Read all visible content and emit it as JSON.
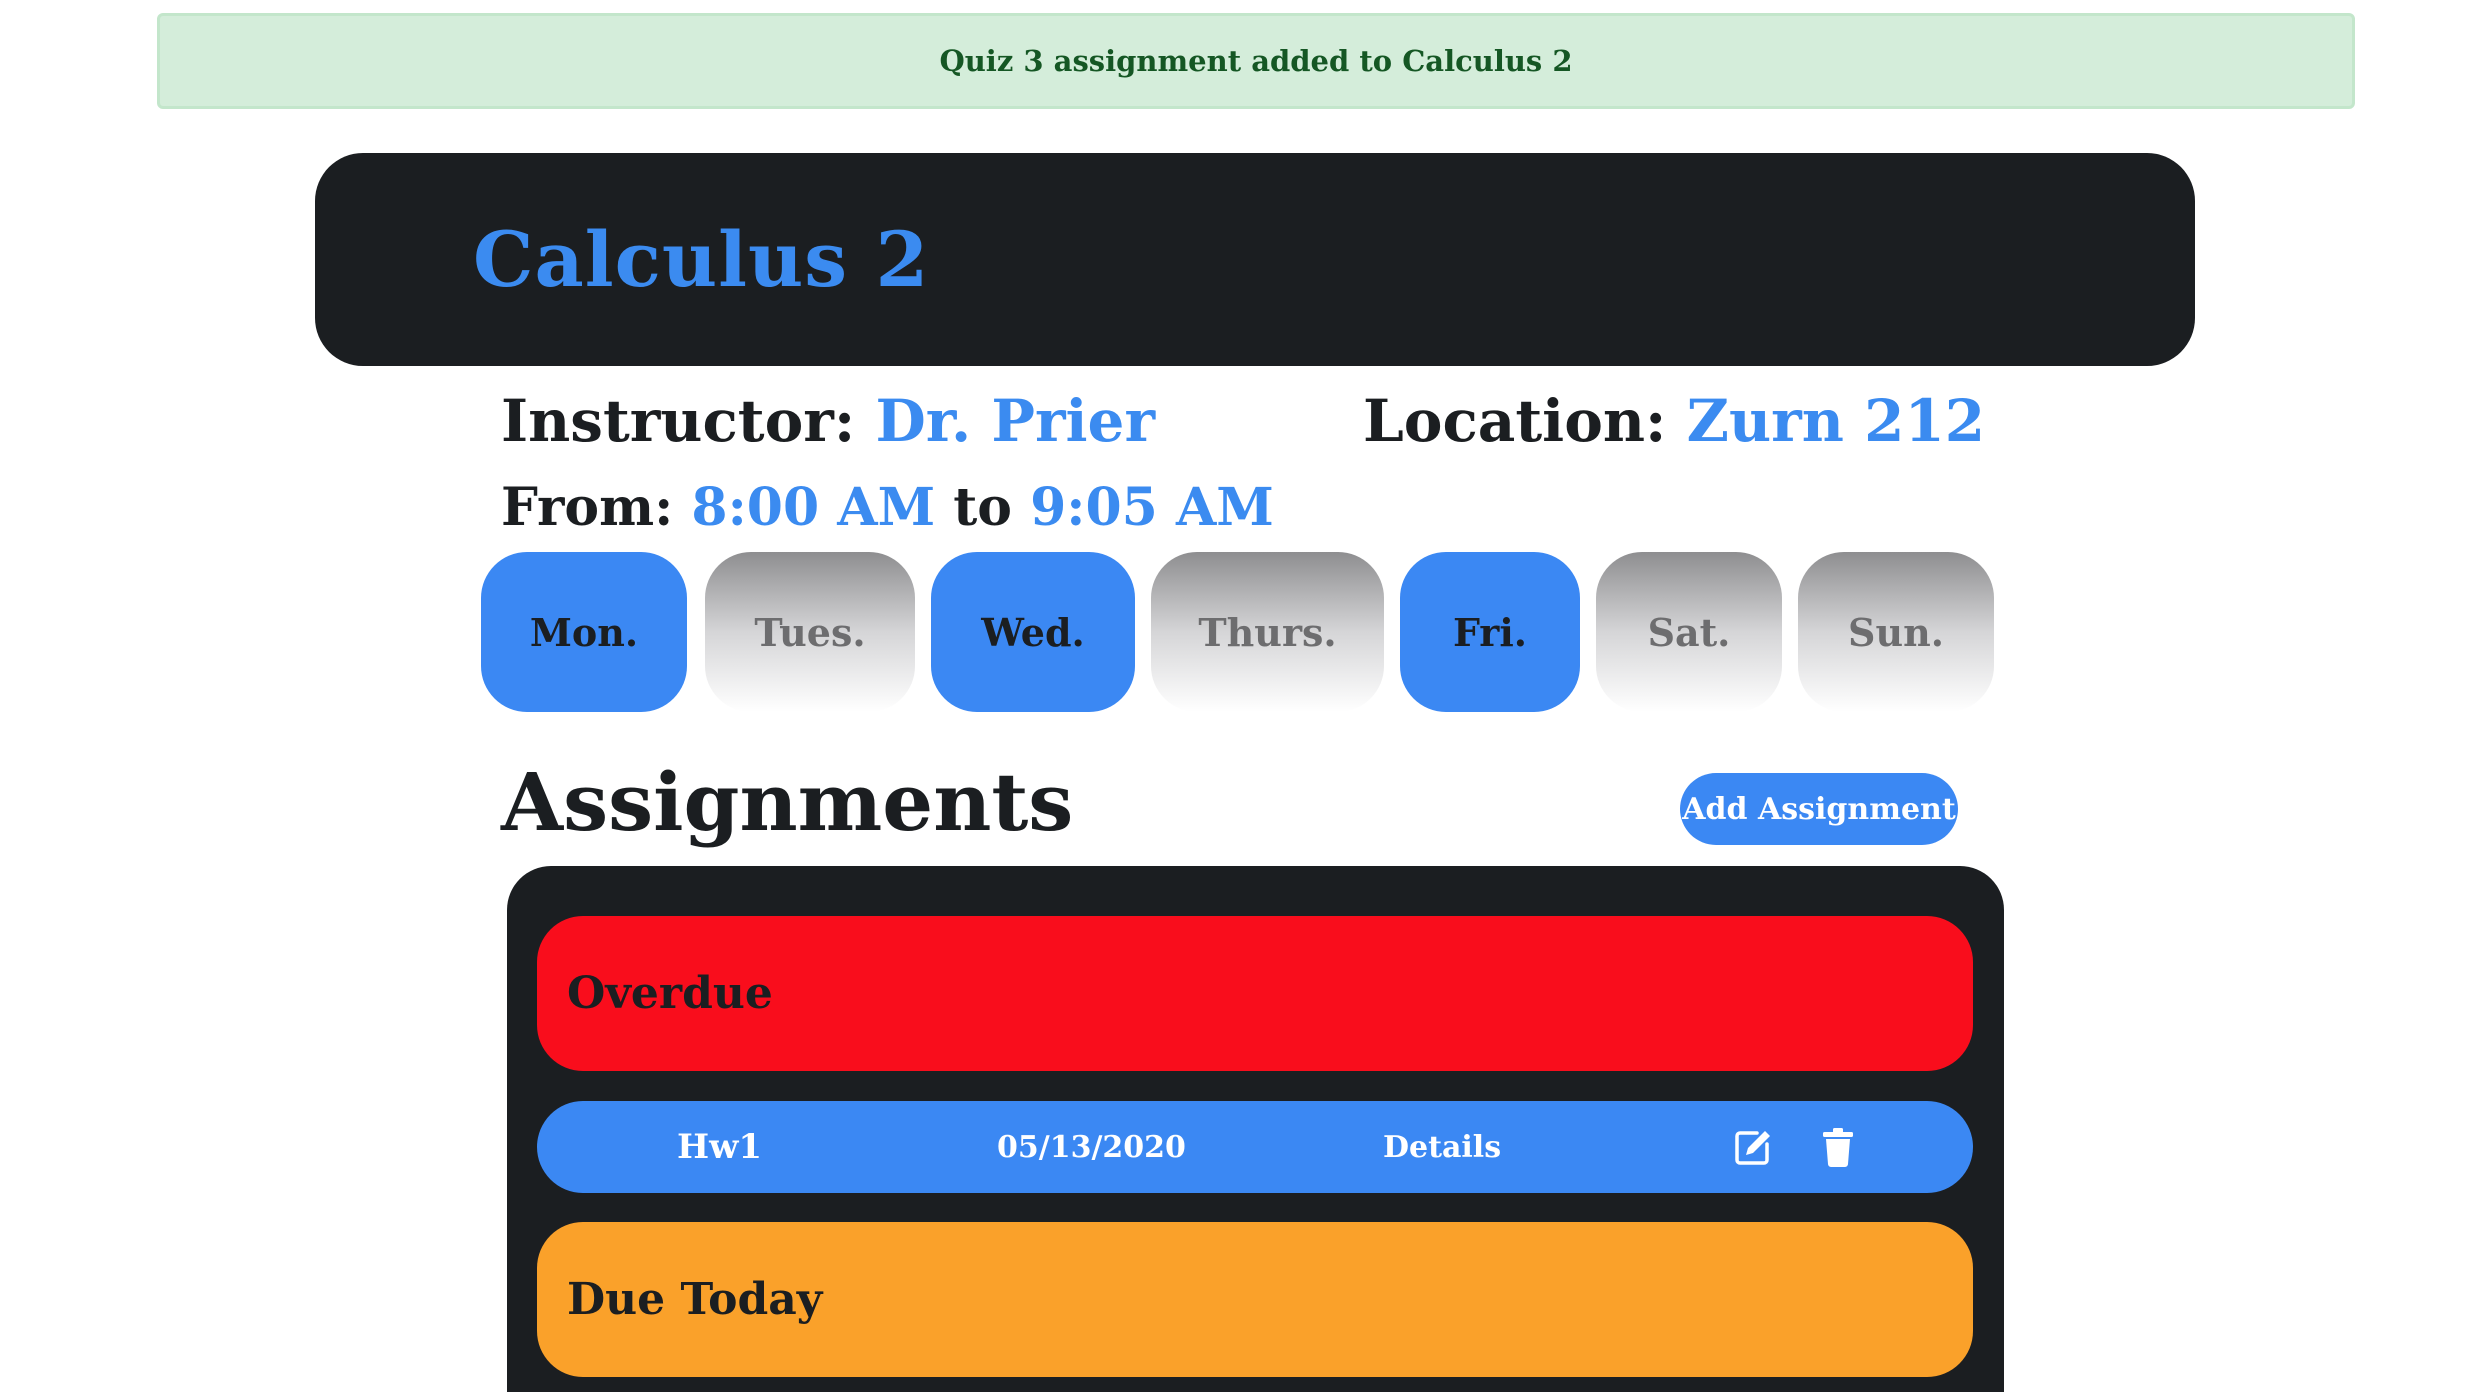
{
  "alert": {
    "message": "Quiz 3 assignment added to Calculus 2"
  },
  "course": {
    "title": "Calculus 2",
    "instructor_label": "Instructor:",
    "instructor": "Dr. Prier",
    "location_label": "Location:",
    "location": "Zurn 212",
    "from_label": "From:",
    "start_time": "8:00 AM",
    "to_label": "to",
    "end_time": "9:05 AM"
  },
  "days": [
    {
      "label": "Mon.",
      "active": true
    },
    {
      "label": "Tues.",
      "active": false
    },
    {
      "label": "Wed.",
      "active": true
    },
    {
      "label": "Thurs.",
      "active": false
    },
    {
      "label": "Fri.",
      "active": true
    },
    {
      "label": "Sat.",
      "active": false
    },
    {
      "label": "Sun.",
      "active": false
    }
  ],
  "assignments": {
    "heading": "Assignments",
    "add_button": "Add Assignment",
    "groups": {
      "overdue": "Overdue",
      "due_today": "Due Today"
    },
    "overdue_items": [
      {
        "name": "Hw1",
        "date": "05/13/2020",
        "details_label": "Details",
        "edit_icon": "edit-icon",
        "delete_icon": "trash-icon"
      }
    ]
  },
  "colors": {
    "accent": "#3b88f3",
    "overdue": "#f90d1c",
    "due_today": "#faa12a",
    "panel": "#1b1e21",
    "alert_bg": "#d4edda",
    "alert_text": "#155724"
  }
}
